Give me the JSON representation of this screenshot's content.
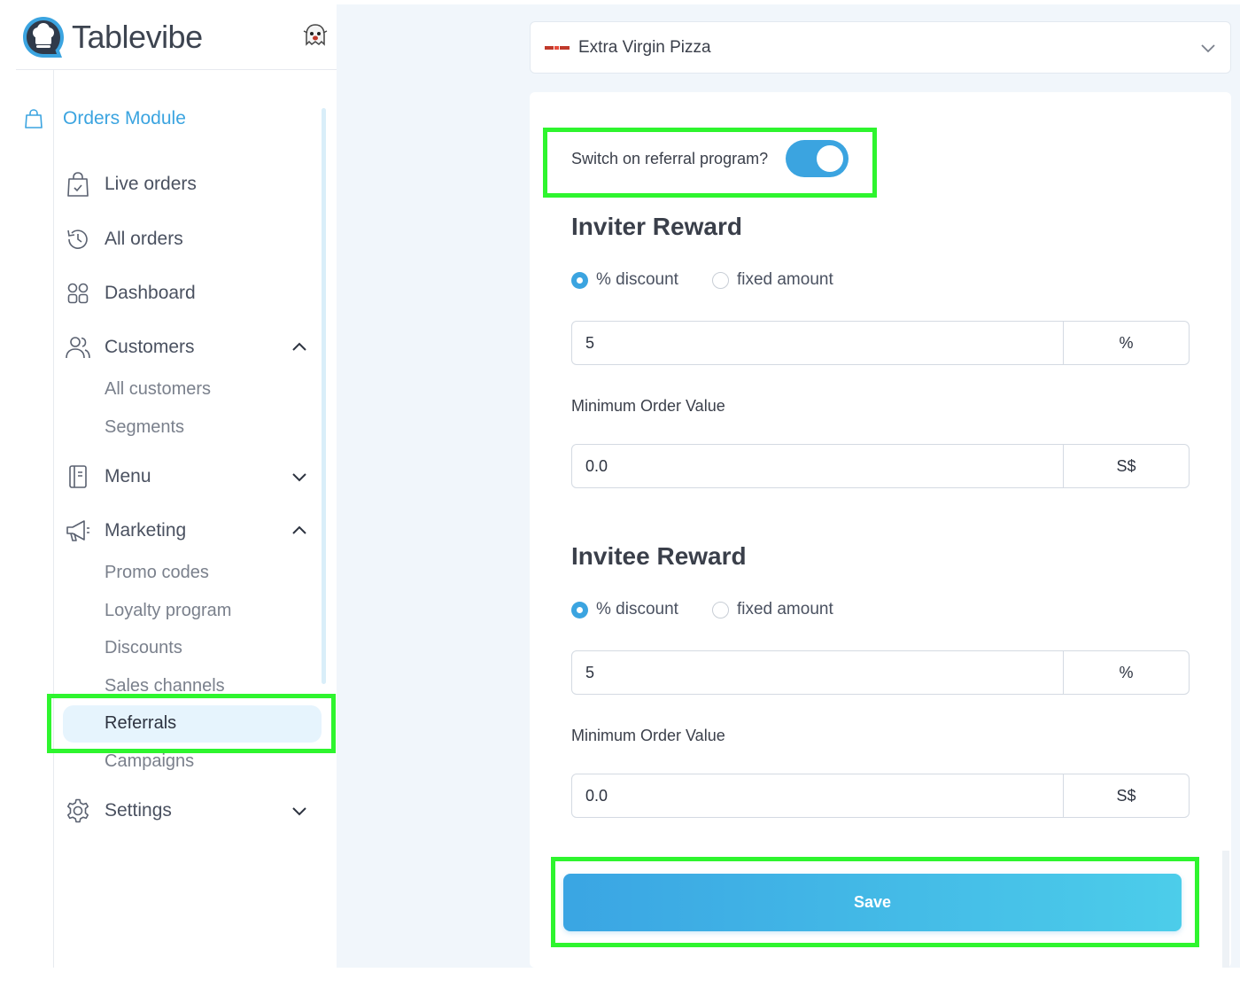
{
  "brand": {
    "name": "Tablevibe"
  },
  "sidebar": {
    "module_label": "Orders Module",
    "items": [
      {
        "label": "Live orders"
      },
      {
        "label": "All orders"
      },
      {
        "label": "Dashboard"
      },
      {
        "label": "Customers",
        "expanded": true,
        "children": [
          {
            "label": "All customers"
          },
          {
            "label": "Segments"
          }
        ]
      },
      {
        "label": "Menu",
        "expanded": false
      },
      {
        "label": "Marketing",
        "expanded": true,
        "children": [
          {
            "label": "Promo codes"
          },
          {
            "label": "Loyalty program"
          },
          {
            "label": "Discounts"
          },
          {
            "label": "Sales channels"
          },
          {
            "label": "Referrals",
            "active": true
          },
          {
            "label": "Campaigns"
          }
        ]
      },
      {
        "label": "Settings",
        "expanded": false
      }
    ]
  },
  "restaurant_select": {
    "value": "Extra Virgin Pizza"
  },
  "referral": {
    "toggle_label": "Switch on referral program?",
    "toggle_on": true,
    "inviter": {
      "title": "Inviter Reward",
      "option_percent": "% discount",
      "option_fixed": "fixed amount",
      "selected": "percent",
      "amount_value": "5",
      "amount_unit": "%",
      "min_order_label": "Minimum Order Value",
      "min_order_value": "0.0",
      "min_order_unit": "S$"
    },
    "invitee": {
      "title": "Invitee Reward",
      "option_percent": "% discount",
      "option_fixed": "fixed amount",
      "selected": "percent",
      "amount_value": "5",
      "amount_unit": "%",
      "min_order_label": "Minimum Order Value",
      "min_order_value": "0.0",
      "min_order_unit": "S$"
    },
    "save_label": "Save"
  },
  "colors": {
    "accent": "#3ba4e0",
    "highlight": "#2ef52e"
  }
}
